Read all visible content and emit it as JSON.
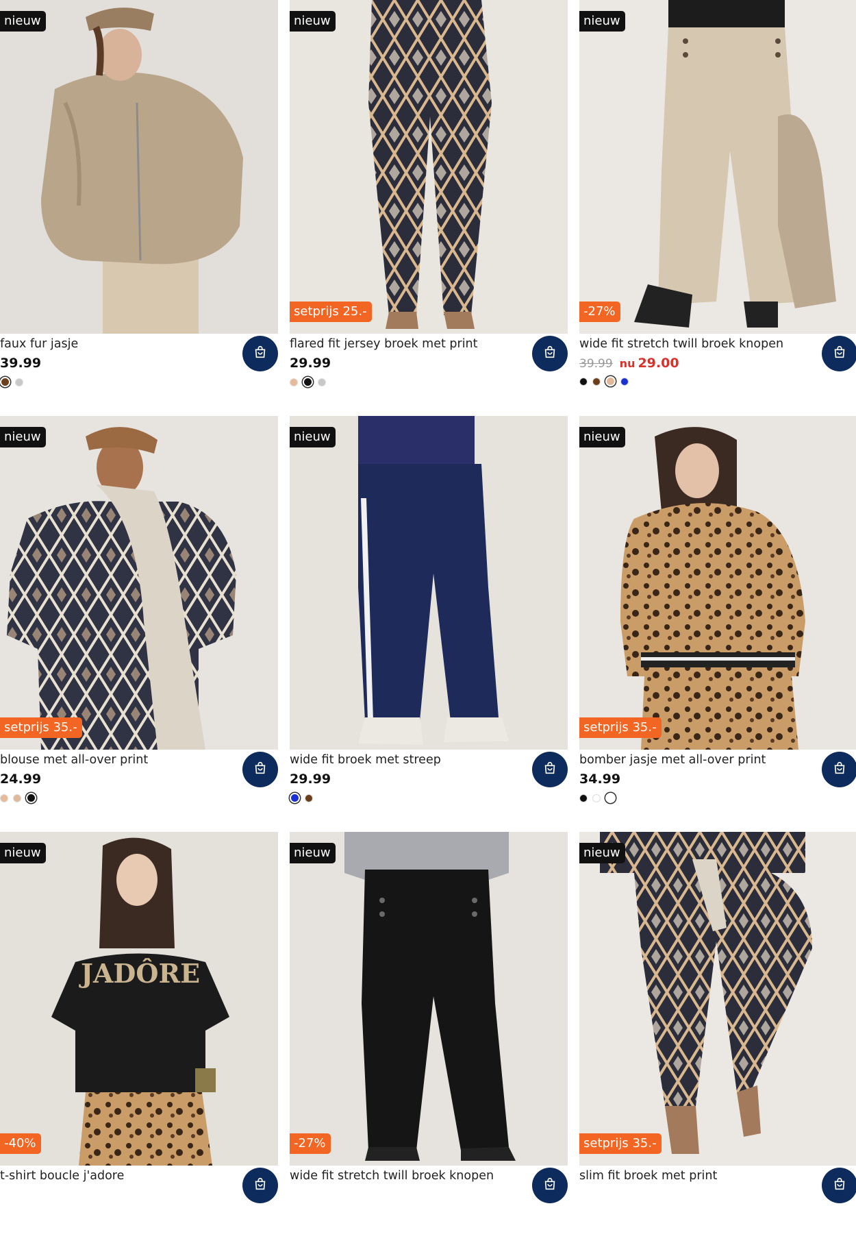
{
  "colors": {
    "accent_navy": "#0d2b5c",
    "promo_orange": "#f26522",
    "sale_red": "#d9322c",
    "badge_black": "#111111"
  },
  "products": [
    {
      "badge": "nieuw",
      "promo": "",
      "title": "faux fur jasje",
      "price": "39.99",
      "old_price": "",
      "nu_label": "",
      "sale_price": "",
      "cart_icon": "shopping-bag-icon",
      "swatches": [
        "#6b3f1c",
        "#c8c8c8"
      ],
      "selected_swatch": 0,
      "image": "woman in beige faux fur jacket and plaid cap"
    },
    {
      "badge": "nieuw",
      "promo": "setprijs 25.-",
      "title": "flared fit jersey broek met print",
      "price": "29.99",
      "old_price": "",
      "nu_label": "",
      "sale_price": "",
      "cart_icon": "shopping-bag-icon",
      "swatches": [
        "#e8b999",
        "#111111",
        "#c8c8c8"
      ],
      "selected_swatch": 1,
      "image": "flared printed trousers"
    },
    {
      "badge": "nieuw",
      "promo": "-27%",
      "title": "wide fit stretch twill broek knopen",
      "price": "",
      "old_price": "39.99",
      "nu_label": "nu",
      "sale_price": "29.00",
      "cart_icon": "shopping-bag-icon",
      "swatches": [
        "#111111",
        "#6b3f1c",
        "#e0b89a",
        "#1a2fd6"
      ],
      "selected_swatch": 2,
      "image": "beige wide trousers with buttons"
    },
    {
      "badge": "nieuw",
      "promo": "setprijs 35.-",
      "title": "blouse met all-over print",
      "price": "24.99",
      "old_price": "",
      "nu_label": "",
      "sale_price": "",
      "cart_icon": "shopping-bag-icon",
      "swatches": [
        "#e8b999",
        "#e0b89a",
        "#111111"
      ],
      "selected_swatch": 2,
      "image": "woman in printed blouse with scarf and cap"
    },
    {
      "badge": "nieuw",
      "promo": "",
      "title": "wide fit broek met streep",
      "price": "29.99",
      "old_price": "",
      "nu_label": "",
      "sale_price": "",
      "cart_icon": "shopping-bag-icon",
      "swatches": [
        "#1a2fd6",
        "#6b3f1c"
      ],
      "selected_swatch": 0,
      "image": "navy wide trousers with side stripe"
    },
    {
      "badge": "nieuw",
      "promo": "setprijs 35.-",
      "title": "bomber jasje met all-over print",
      "price": "34.99",
      "old_price": "",
      "nu_label": "",
      "sale_price": "",
      "cart_icon": "shopping-bag-icon",
      "swatches": [
        "#111111",
        "#ffffff",
        "#ffffff"
      ],
      "selected_swatch": 2,
      "image": "woman in leopard print bomber jacket"
    },
    {
      "badge": "nieuw",
      "promo": "-40%",
      "title": "t-shirt boucle j'adore",
      "price": "",
      "old_price": "",
      "nu_label": "",
      "sale_price": "",
      "cart_icon": "shopping-bag-icon",
      "swatches": [],
      "selected_swatch": -1,
      "image": "woman in black JADORE t-shirt"
    },
    {
      "badge": "nieuw",
      "promo": "-27%",
      "title": "wide fit stretch twill broek knopen",
      "price": "",
      "old_price": "",
      "nu_label": "",
      "sale_price": "",
      "cart_icon": "shopping-bag-icon",
      "swatches": [],
      "selected_swatch": -1,
      "image": "black wide trousers with buttons"
    },
    {
      "badge": "nieuw",
      "promo": "setprijs 35.-",
      "title": "slim fit broek met print",
      "price": "",
      "old_price": "",
      "nu_label": "",
      "sale_price": "",
      "cart_icon": "shopping-bag-icon",
      "swatches": [],
      "selected_swatch": -1,
      "image": "slim printed trousers"
    }
  ],
  "print_text": "JADÔRE"
}
